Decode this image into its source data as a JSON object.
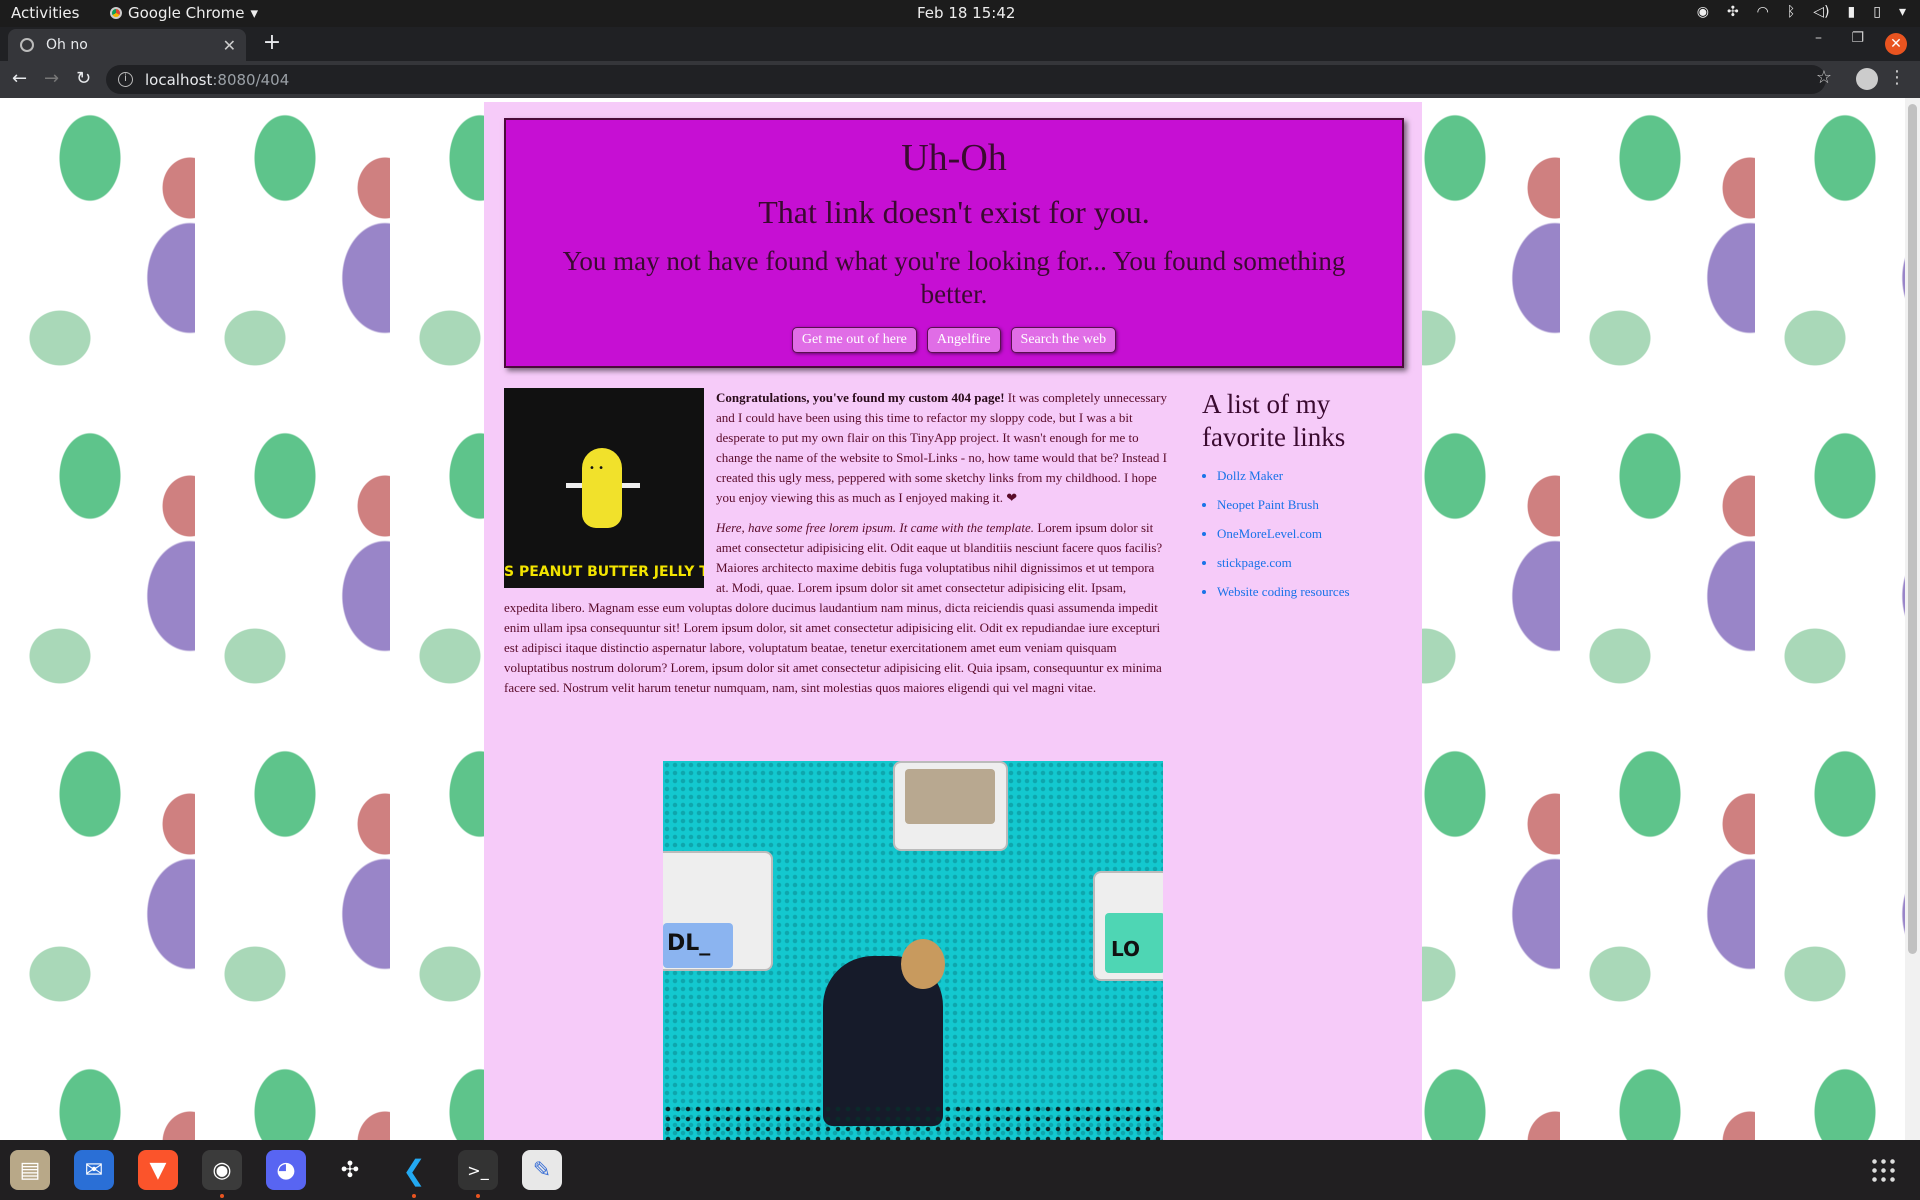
{
  "topbar": {
    "activities": "Activities",
    "app_name": "Google Chrome",
    "clock": "Feb 18  15:42"
  },
  "browser": {
    "tab_title": "Oh no",
    "url_host": "localhost",
    "url_path": ":8080/404"
  },
  "hero": {
    "title": "Uh-Oh",
    "subtitle": "That link doesn't exist for you.",
    "message": "You may not have found what you're looking for... You found something better.",
    "buttons": [
      "Get me out of here",
      "Angelfire",
      "Search the web"
    ]
  },
  "gif_caption": "S PEANUT BUTTER JELLY TIME",
  "article": {
    "intro_bold": "Congratulations, you've found my custom 404 page!",
    "intro_text": " It was completely unnecessary and I could have been using this time to refactor my sloppy code, but I was a bit desperate to put my own flair on this TinyApp project. It wasn't enough for me to change the name of the website to Smol-Links - no, how tame would that be? Instead I created this ugly mess, peppered with some sketchy links from my childhood. I hope you enjoy viewing this as much as I enjoyed making it. ❤",
    "lorem_italic": "Here, have some free lorem ipsum. It came with the template.",
    "lorem_text": " Lorem ipsum dolor sit amet consectetur adipisicing elit. Odit eaque ut blanditiis nesciunt facere quos facilis? Maiores architecto maxime debitis fuga voluptatibus nihil dignissimos et ut tempora at. Modi, quae. Lorem ipsum dolor sit amet consectetur adipisicing elit. Ipsam, expedita libero. Magnam esse eum voluptas dolore ducimus laudantium nam minus, dicta reiciendis quasi assumenda impedit enim ullam ipsa consequuntur sit! Lorem ipsum dolor, sit amet consectetur adipisicing elit. Odit ex repudiandae iure excepturi est adipisci itaque distinctio aspernatur labore, voluptatum beatae, tenetur exercitationem amet eum veniam quisquam voluptatibus nostrum dolorum? Lorem, ipsum dolor sit amet consectetur adipisicing elit. Quia ipsam, consequuntur ex minima facere sed. Nostrum velit harum tenetur numquam, nam, sint molestias quos maiores eligendi qui vel magni vitae."
  },
  "surfer_screen_texts": [
    "DL_",
    "LO"
  ],
  "sidebar": {
    "title": "A list of my favorite links",
    "links": [
      "Dollz Maker",
      "Neopet Paint Brush",
      "OneMoreLevel.com",
      "stickpage.com",
      "Website coding resources"
    ]
  },
  "colors": {
    "page_bg": "#f6cbf9",
    "hero_bg": "#c60fd3",
    "text": "#3a0a30",
    "link": "#1a73e8"
  }
}
